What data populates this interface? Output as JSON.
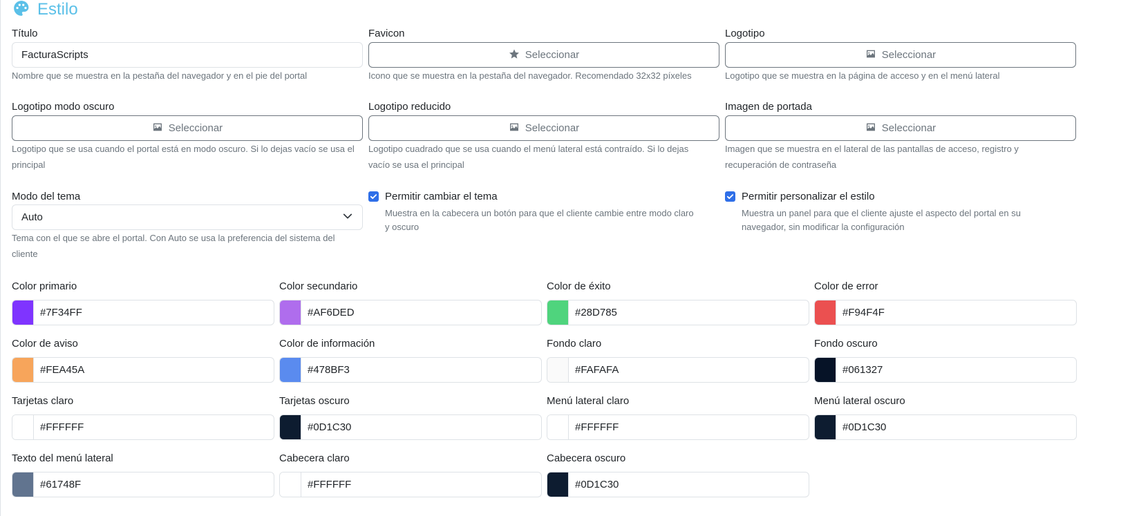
{
  "section": {
    "title": "Estilo",
    "icon": "palette-icon",
    "accent": "#5BC0E8"
  },
  "fields": {
    "titulo": {
      "label": "Título",
      "value": "FacturaScripts",
      "help": "Nombre que se muestra en la pestaña del navegador y en el pie del portal"
    },
    "favicon": {
      "label": "Favicon",
      "button": "Seleccionar",
      "icon": "star-icon",
      "help": "Icono que se muestra en la pestaña del navegador. Recomendado 32x32 píxeles"
    },
    "logotipo": {
      "label": "Logotipo",
      "button": "Seleccionar",
      "icon": "image-icon",
      "help": "Logotipo que se muestra en la página de acceso y en el menú lateral"
    },
    "logotipo_oscuro": {
      "label": "Logotipo modo oscuro",
      "button": "Seleccionar",
      "icon": "image-icon",
      "help_1": "Logotipo que se usa cuando el portal está en modo oscuro. Si lo dejas vacío se usa el",
      "help_2": "principal"
    },
    "logotipo_reducido": {
      "label": "Logotipo reducido",
      "button": "Seleccionar",
      "icon": "image-icon",
      "help_1": "Logotipo cuadrado que se usa cuando el menú lateral está contraído. Si lo dejas",
      "help_2": "vacío se usa el principal"
    },
    "imagen_portada": {
      "label": "Imagen de portada",
      "button": "Seleccionar",
      "icon": "image-icon",
      "help_1": "Imagen que se muestra en el lateral de las pantallas de acceso, registro y",
      "help_2": "recuperación de contraseña"
    },
    "modo_tema": {
      "label": "Modo del tema",
      "value": "Auto",
      "help_1": "Tema con el que se abre el portal. Con Auto se usa la preferencia del sistema del",
      "help_2": "cliente"
    },
    "permitir_cambiar": {
      "label": "Permitir cambiar el tema",
      "checked": true,
      "help_1": "Muestra en la cabecera un botón para que el cliente cambie entre modo claro",
      "help_2": "y oscuro"
    },
    "permitir_personalizar": {
      "label": "Permitir personalizar el estilo",
      "checked": true,
      "help_1": "Muestra un panel para que el cliente ajuste el aspecto del portal en su",
      "help_2": "navegador, sin modificar la configuración"
    }
  },
  "colors": [
    {
      "label": "Color primario",
      "value": "#7F34FF",
      "swatch": "#7F34FF"
    },
    {
      "label": "Color secundario",
      "value": "#AF6DED",
      "swatch": "#AF6DED"
    },
    {
      "label": "Color de éxito",
      "value": "#28D785",
      "swatch": "#4FD47D"
    },
    {
      "label": "Color de error",
      "value": "#F94F4F",
      "swatch": "#EB5050"
    },
    {
      "label": "Color de aviso",
      "value": "#FEA45A",
      "swatch": "#F7A55B"
    },
    {
      "label": "Color de información",
      "value": "#478BF3",
      "swatch": "#5A8BEF"
    },
    {
      "label": "Fondo claro",
      "value": "#FAFAFA",
      "swatch": "#FAFAFA"
    },
    {
      "label": "Fondo oscuro",
      "value": "#061327",
      "swatch": "#061327"
    },
    {
      "label": "Tarjetas claro",
      "value": "#FFFFFF",
      "swatch": "#FFFFFF"
    },
    {
      "label": "Tarjetas oscuro",
      "value": "#0D1C30",
      "swatch": "#0D1C30"
    },
    {
      "label": "Menú lateral claro",
      "value": "#FFFFFF",
      "swatch": "#FFFFFF"
    },
    {
      "label": "Menú lateral oscuro",
      "value": "#0D1C30",
      "swatch": "#0D1C30"
    },
    {
      "label": "Texto del menú lateral",
      "value": "#61748F",
      "swatch": "#61748F"
    },
    {
      "label": "Cabecera claro",
      "value": "#FFFFFF",
      "swatch": "#FFFFFF"
    },
    {
      "label": "Cabecera oscuro",
      "value": "#0D1C30",
      "swatch": "#0D1C30"
    }
  ]
}
